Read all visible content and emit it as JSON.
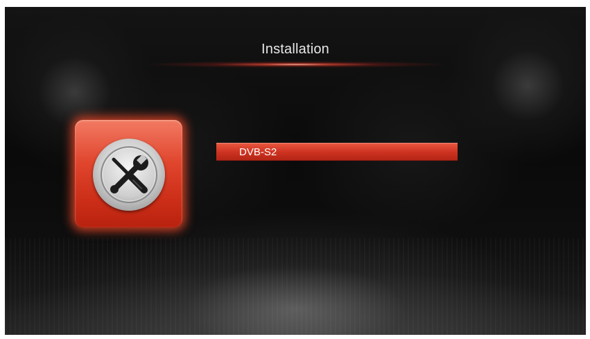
{
  "screen": {
    "title": "Installation"
  },
  "category": {
    "icon": "tools-icon"
  },
  "menu": {
    "items": [
      {
        "label": "DVB-S2",
        "selected": true
      }
    ]
  },
  "colors": {
    "accent": "#d63a26",
    "background": "#0b0b0b",
    "text": "#ffffff"
  }
}
